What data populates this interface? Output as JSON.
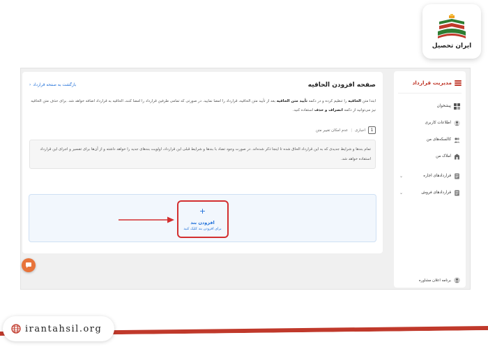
{
  "brand": {
    "name": "ایران تحصیل",
    "website": "irantahsil.org",
    "colors": {
      "red": "#c0392b",
      "green": "#2e7d32",
      "orange": "#e8743b"
    }
  },
  "sidebar": {
    "title": "مدیریت قرارداد",
    "items": [
      {
        "label": "پیشخوان",
        "icon": "dashboard-icon"
      },
      {
        "label": "اطلاعات کاربری",
        "icon": "user-icon"
      },
      {
        "label": "کالسکه‌های من",
        "icon": "people-icon"
      },
      {
        "label": "املاک من",
        "icon": "building-icon"
      },
      {
        "label": "قراردادهای اجاره",
        "icon": "document-icon",
        "expandable": true
      },
      {
        "label": "قراردادهای فروش",
        "icon": "document-icon",
        "expandable": true
      }
    ],
    "footer": "برنامه اعلان مشاوره"
  },
  "main": {
    "title": "صفحه افزودن الحاقیه",
    "back_link": "بازگشت به صفحه قرارداد",
    "intro_part1": "ابتدا متن ",
    "intro_bold1": "الحاقیه",
    "intro_part2": " را تنظیم کرده و در دکمه ",
    "intro_bold2": "تأیید متن الحاقیه",
    "intro_part3": " بعد از تأیید متن الحاقیه، قرارداد را امضا نمایید. در صورتی که تمامی طرفین قرارداد را امضا کنند، الحاقیه به قرارداد اضافه خواهد شد. برای حذف متن الحاقیه نیز می‌توانید از دکمه ",
    "intro_bold3": "انصراف و حذف",
    "intro_part4": " استفاده کنید.",
    "clause": {
      "number": "1",
      "type": "اجباری",
      "note": "عدم امکان تغییر متن",
      "text": "تمام بندها و شرایط جدیدی که به این قرارداد الحاق شده تا اینجا ذکر شده‌اند. در صورت وجود تضاد با بندها و شرایط قبلی این قرارداد، اولویت بندهای جدید را خواهد داشته و از آن‌ها برای تفسیر و اجرای این قرارداد استفاده خواهد شد."
    },
    "add_clause": {
      "plus": "+",
      "title": "افزودن بند",
      "subtitle": "برای افزودن بند کلیک کنید"
    }
  }
}
